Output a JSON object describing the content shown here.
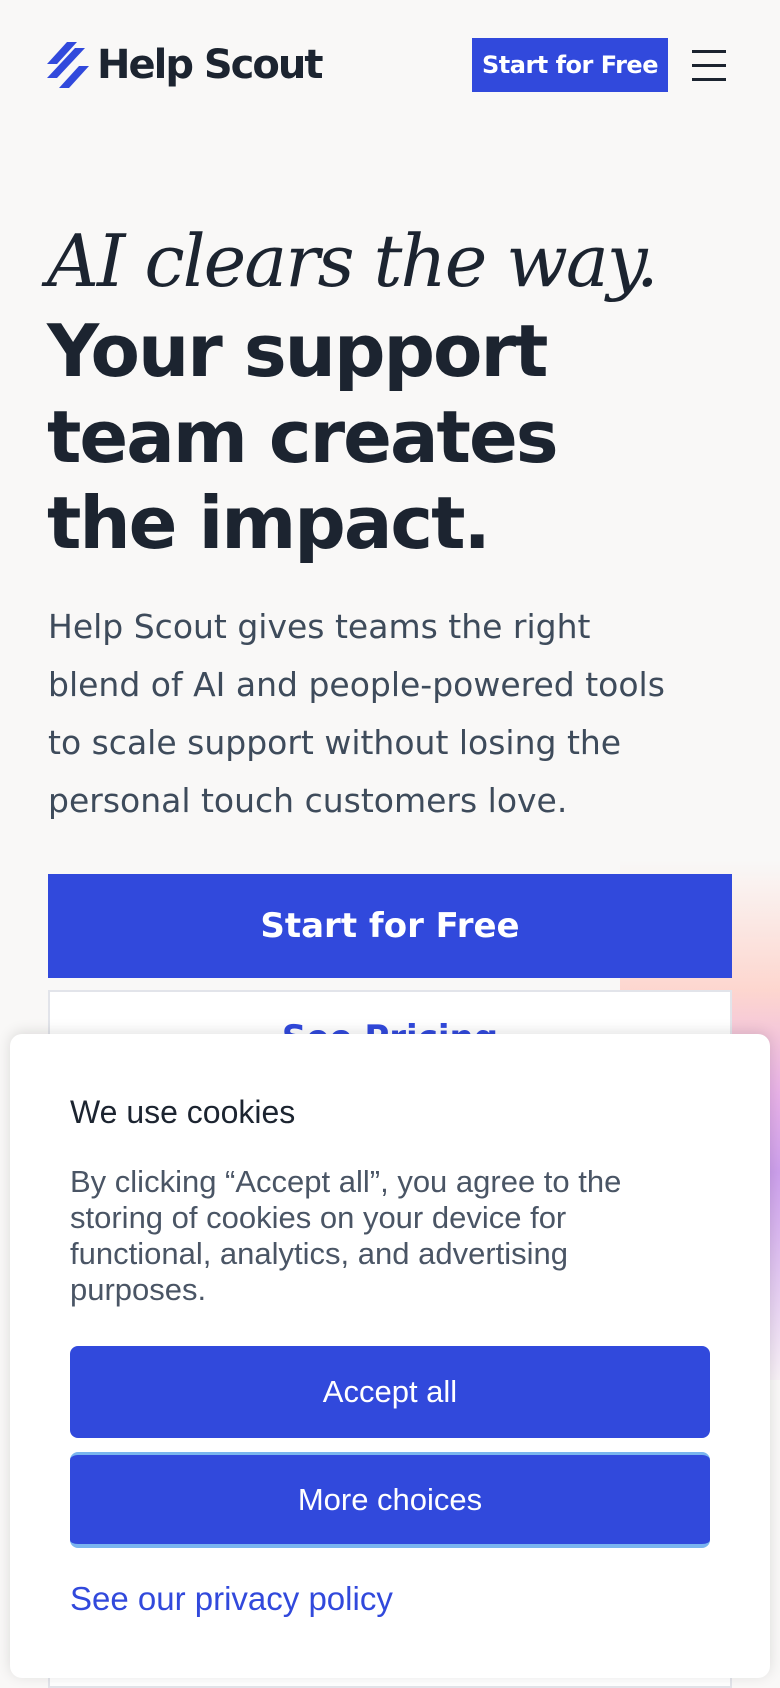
{
  "header": {
    "logo_text": "Help Scout",
    "cta_label": "Start for Free",
    "menu_icon": "hamburger-menu-icon"
  },
  "hero": {
    "italic_line": "AI clears the way.",
    "bold_line": "Your support team creates the impact.",
    "subtitle": "Help Scout gives teams the right blend of AI and people-powered tools to scale support without losing the personal touch customers love.",
    "primary_cta": "Start for Free",
    "secondary_cta": "See Pricing"
  },
  "cookie_banner": {
    "title": "We use cookies",
    "body": "By clicking “Accept all”, you agree to the storing of cookies on your device for functional, analytics, and advertising purposes.",
    "accept_label": "Accept all",
    "more_label": "More choices",
    "policy_link": "See our privacy policy"
  },
  "colors": {
    "brand": "#3149dc",
    "text": "#1c2430",
    "muted": "#3e4b5b",
    "background": "#f9f8f7"
  }
}
